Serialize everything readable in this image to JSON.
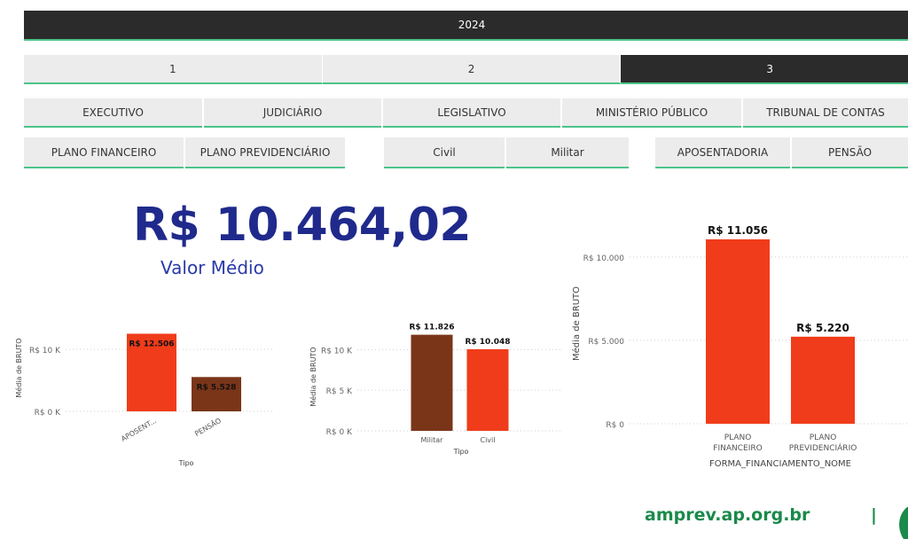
{
  "header": {
    "year": "2024"
  },
  "tabs": [
    {
      "label": "1",
      "active": false
    },
    {
      "label": "2",
      "active": false
    },
    {
      "label": "3",
      "active": true
    }
  ],
  "powers": [
    "EXECUTIVO",
    "JUDICIÁRIO",
    "LEGISLATIVO",
    "MINISTÉRIO PÚBLICO",
    "TRIBUNAL DE CONTAS"
  ],
  "plans": [
    "PLANO FINANCEIRO",
    "PLANO PREVIDENCIÁRIO"
  ],
  "categories_filter": [
    "Civil",
    "Militar"
  ],
  "benefit_types": [
    "APOSENTADORIA",
    "PENSÃO"
  ],
  "kpi": {
    "value": "R$ 10.464,02",
    "label": "Valor Médio"
  },
  "colors": {
    "accent_green": "#4cc48a",
    "orange": "#f03c1a",
    "brown": "#7a3519",
    "navy": "#1f2a8c"
  },
  "chart_data": [
    {
      "type": "bar",
      "categories": [
        "APOSENT...",
        "PENSÃO"
      ],
      "values": [
        12506,
        5528
      ],
      "data_labels": [
        "R$ 12.506",
        "R$ 5.528"
      ],
      "colors": [
        "#f03c1a",
        "#7a3519"
      ],
      "xlabel": "Tipo",
      "ylabel": "Média de BRUTO",
      "ylim": [
        0,
        15000
      ],
      "yticks": [
        0,
        10000
      ],
      "ytick_labels": [
        "R$ 0 K",
        "R$ 10 K"
      ],
      "grid": true
    },
    {
      "type": "bar",
      "categories": [
        "Militar",
        "Civil"
      ],
      "values": [
        11826,
        10048
      ],
      "data_labels": [
        "R$ 11.826",
        "R$ 10.048"
      ],
      "colors": [
        "#7a3519",
        "#f03c1a"
      ],
      "xlabel": "Tipo",
      "ylabel": "Média de BRUTO",
      "ylim": [
        0,
        12000
      ],
      "yticks": [
        0,
        5000,
        10000
      ],
      "ytick_labels": [
        "R$ 0 K",
        "R$ 5 K",
        "R$ 10 K"
      ],
      "grid": true
    },
    {
      "type": "bar",
      "categories": [
        "PLANO FINANCEIRO",
        "PLANO PREVIDENCIÁRIO"
      ],
      "values": [
        11056,
        5220
      ],
      "data_labels": [
        "R$ 11.056",
        "R$ 5.220"
      ],
      "colors": [
        "#f03c1a",
        "#f03c1a"
      ],
      "xlabel": "FORMA_FINANCIAMENTO_NOME",
      "ylabel": "Média de BRUTO",
      "ylim": [
        0,
        11056
      ],
      "yticks": [
        0,
        5000,
        10000
      ],
      "ytick_labels": [
        "R$ 0",
        "R$ 5.000",
        "R$ 10.000"
      ],
      "grid": true
    }
  ],
  "footer": {
    "url": "amprev.ap.org.br",
    "separator": "|"
  }
}
